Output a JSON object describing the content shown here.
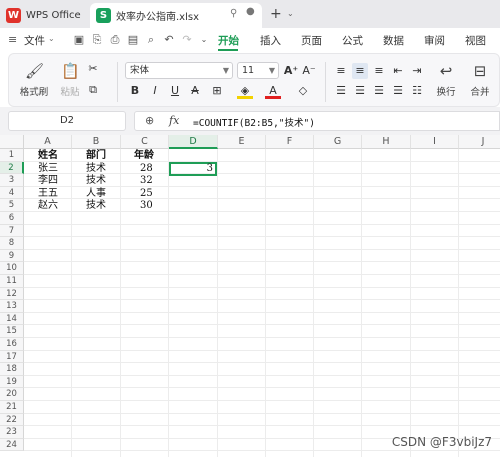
{
  "tabs": {
    "app": "WPS Office",
    "file": "效率办公指南.xlsx"
  },
  "menu": {
    "file": "文件",
    "start": "开始",
    "insert": "插入",
    "page": "页面",
    "formula": "公式",
    "data": "数据",
    "review": "审阅",
    "view": "视图"
  },
  "ribbon": {
    "format_painter": "格式刷",
    "paste": "粘贴",
    "font_name": "宋体",
    "font_size": "11",
    "wrap": "换行",
    "merge": "合并"
  },
  "formula_bar": {
    "cell_ref": "D2",
    "fx": "fx",
    "formula": "=COUNTIF(B2:B5,\"技术\")"
  },
  "columns": [
    "A",
    "B",
    "C",
    "D",
    "E",
    "F",
    "G",
    "H",
    "I",
    "J"
  ],
  "rows": [
    "1",
    "2",
    "3",
    "4",
    "5",
    "6",
    "7",
    "8",
    "9",
    "10",
    "11",
    "12",
    "13",
    "14",
    "15",
    "16",
    "17",
    "18",
    "19",
    "20",
    "21",
    "22",
    "23",
    "24"
  ],
  "cells": {
    "a1": "姓名",
    "b1": "部门",
    "c1": "年龄",
    "a2": "张三",
    "b2": "技术",
    "c2": "28",
    "d2": "3",
    "a3": "李四",
    "b3": "技术",
    "c3": "32",
    "a4": "王五",
    "b4": "人事",
    "c4": "25",
    "a5": "赵六",
    "b5": "技术",
    "c5": "30"
  },
  "watermark": "CSDN @F3vbiJz7",
  "colors": {
    "accent": "#1e9d56",
    "tab_bg": "#e9e9ec",
    "wps_red": "#e0322b"
  }
}
